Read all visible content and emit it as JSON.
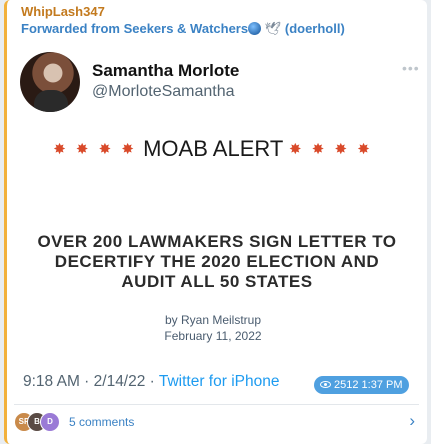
{
  "message": {
    "sender": "WhipLash347",
    "forward_prefix": "Forwarded from Seekers & Watchers",
    "forward_suffix": "(doerholl)",
    "time": "1:37 PM",
    "views": "2512"
  },
  "tweet": {
    "author_name": "Samantha Morlote",
    "author_handle": "@MorloteSamantha",
    "alert_burst": "✸ ✸ ✸ ✸",
    "alert_text": "MOAB ALERT",
    "headline": "OVER 200 LAWMAKERS SIGN LETTER TO DECERTIFY THE 2020 ELECTION AND AUDIT ALL 50 STATES",
    "byline": "by Ryan Meilstrup",
    "article_date": "February 11, 2022",
    "meta_time": "9:18 AM · 2/14/22 · ",
    "meta_via": "Twitter for iPhone"
  },
  "comments": {
    "label": "5 comments",
    "avatars": [
      "SP",
      "B",
      "D"
    ]
  },
  "colors": {
    "sender": "#c37a1e",
    "link": "#3b82c4",
    "accent_border": "#f2b13b",
    "pill": "#4fa0e0"
  }
}
